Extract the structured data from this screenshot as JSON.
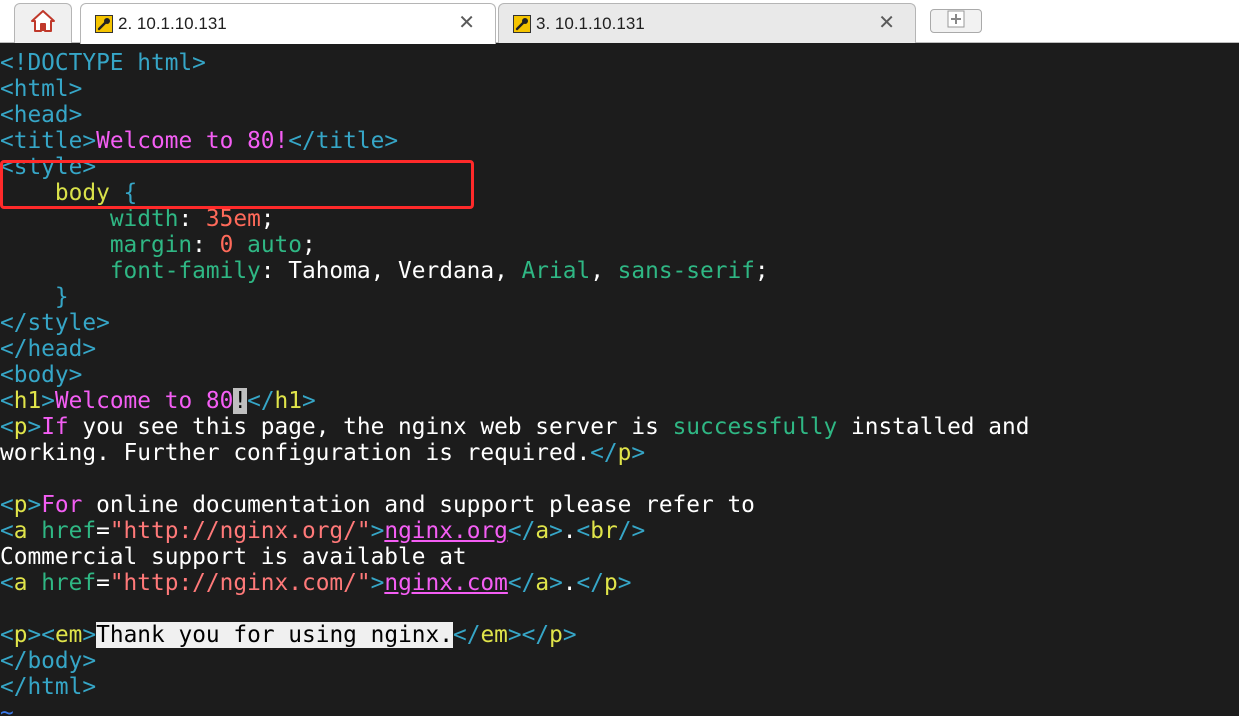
{
  "tabs": {
    "home_icon": "home-icon",
    "active": {
      "number": "2.",
      "host": "10.1.10.131",
      "close": "✕"
    },
    "inactive": {
      "number": "3.",
      "host": "10.1.10.131",
      "close": "✕"
    },
    "new_tab_icon": "plus-icon"
  },
  "terminal": {
    "lines": [
      "<!DOCTYPE html>",
      "<html>",
      "<head>",
      "<title>Welcome to 80!</title>",
      "<style>",
      "    body {",
      "        width: 35em;",
      "        margin: 0 auto;",
      "        font-family: Tahoma, Verdana, Arial, sans-serif;",
      "    }",
      "</style>",
      "</head>",
      "<body>",
      "<h1>Welcome to 80!</h1>",
      "<p>If you see this page, the nginx web server is successfully installed and",
      "working. Further configuration is required.</p>",
      "",
      "<p>For online documentation and support please refer to",
      "<a href=\"http://nginx.org/\">nginx.org</a>.<br/>",
      "Commercial support is available at",
      "<a href=\"http://nginx.com/\">nginx.com</a>.</p>",
      "",
      "<p><em>Thank you for using nginx.</em></p>",
      "</body>",
      "</html>",
      "~"
    ]
  },
  "colors": {
    "background": "#1c1c1c",
    "highlight_box": "#ff2a2a",
    "tag": "#36a6c7",
    "text_magenta": "#f45ef4",
    "css_property": "#2fb784",
    "css_value": "#ff6a5a"
  }
}
